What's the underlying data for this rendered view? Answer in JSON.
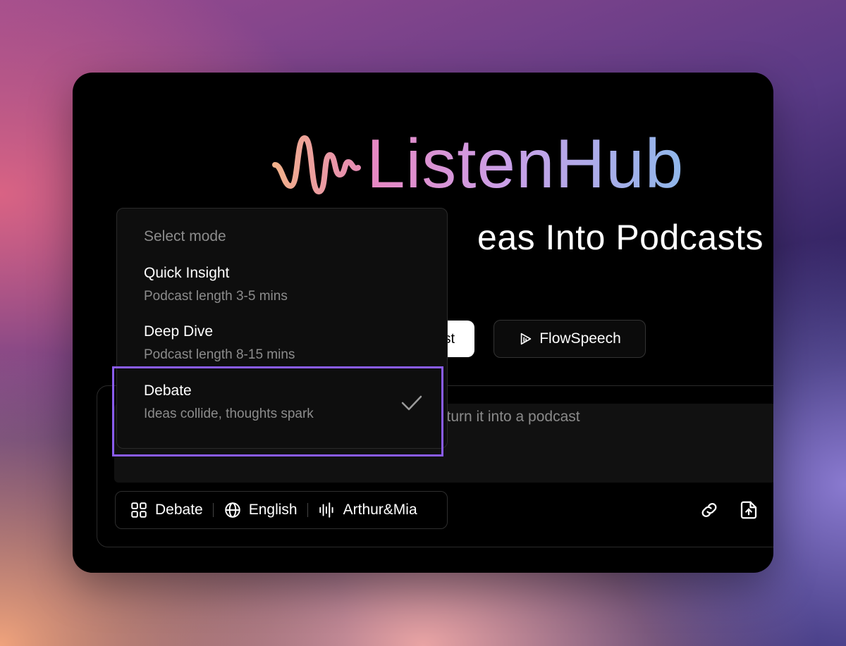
{
  "brand": {
    "name": "ListenHub"
  },
  "hero": {
    "headline_visible": "eas Into Podcasts"
  },
  "mode_tabs": {
    "active_label_partial": "st",
    "flowspeech_label": "FlowSpeech"
  },
  "composer": {
    "placeholder_visible": "l turn it into a podcast"
  },
  "settings": {
    "mode": "Debate",
    "language": "English",
    "voices": "Arthur&Mia"
  },
  "dropdown": {
    "header": "Select mode",
    "items": [
      {
        "title": "Quick Insight",
        "subtitle": "Podcast length 3-5 mins"
      },
      {
        "title": "Deep Dive",
        "subtitle": "Podcast length 8-15 mins"
      },
      {
        "title": "Debate",
        "subtitle": "Ideas collide, thoughts spark",
        "selected": true
      }
    ]
  },
  "colors": {
    "selection": "#8a5cf0",
    "brand_gradient": [
      "#e987c2",
      "#c9a0e8",
      "#8fb7ea"
    ]
  },
  "icons": [
    "wave-logo-icon",
    "flowspeech-icon",
    "grid-icon",
    "globe-icon",
    "audio-bars-icon",
    "link-icon",
    "upload-icon",
    "check-icon"
  ]
}
